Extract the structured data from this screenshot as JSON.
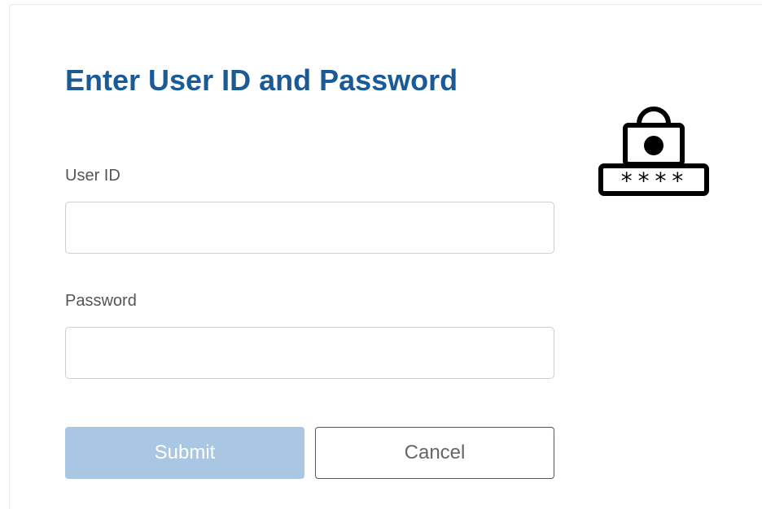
{
  "form": {
    "title": "Enter User ID and Password",
    "userid_label": "User ID",
    "userid_value": "",
    "password_label": "Password",
    "password_value": ""
  },
  "buttons": {
    "submit_label": "Submit",
    "cancel_label": "Cancel"
  },
  "icon": {
    "name": "lock-password-icon",
    "mask_text": "****"
  },
  "colors": {
    "title": "#1a5a96",
    "submit_bg": "#a9c7e2",
    "submit_text": "#ffffff"
  }
}
